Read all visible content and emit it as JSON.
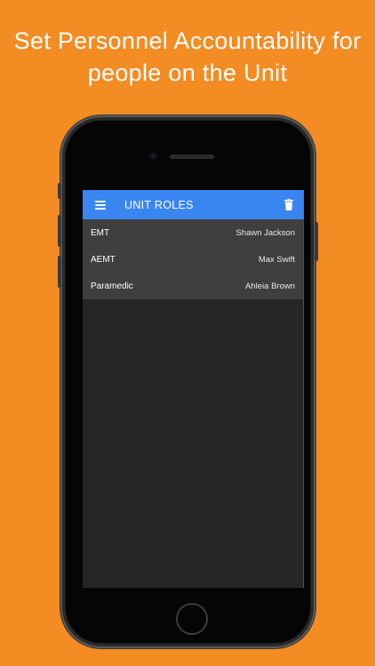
{
  "headline": {
    "line1": "Set Personnel Accountability for",
    "line2": "people on the Unit"
  },
  "appbar": {
    "menu_icon": "menu-icon",
    "title": "UNIT ROLES",
    "action_icon": "trash-icon"
  },
  "roles": [
    {
      "role": "EMT",
      "name": "Shawn Jackson"
    },
    {
      "role": "AEMT",
      "name": "Max Swift"
    },
    {
      "role": "Paramedic",
      "name": "Ahleia Brown"
    }
  ],
  "colors": {
    "background": "#F28C23",
    "appbar": "#3A86F0",
    "screen": "#262626",
    "list": "#3f3f3f"
  }
}
